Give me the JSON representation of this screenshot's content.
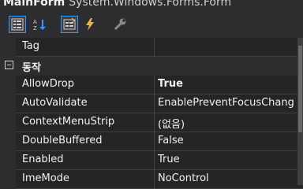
{
  "title": {
    "name": "MainForm",
    "type": "System.Windows.Forms.Form"
  },
  "toolbar": {
    "buttons": [
      {
        "icon": "categorized-icon",
        "active": true
      },
      {
        "icon": "alphabetical-sort-icon",
        "active": false
      },
      {
        "icon": "properties-icon",
        "active": true
      },
      {
        "icon": "events-lightning-icon",
        "active": false
      },
      {
        "icon": "property-pages-wrench-icon",
        "active": false
      }
    ]
  },
  "grid": {
    "tag_row": {
      "name": "Tag",
      "value": ""
    },
    "category": {
      "label": "동작",
      "expanded": true
    },
    "rows": [
      {
        "name": "AllowDrop",
        "value": "True",
        "bold": true
      },
      {
        "name": "AutoValidate",
        "value": "EnablePreventFocusChang",
        "bold": false
      },
      {
        "name": "ContextMenuStrip",
        "value": "(없음)",
        "bold": false
      },
      {
        "name": "DoubleBuffered",
        "value": "False",
        "bold": false
      },
      {
        "name": "Enabled",
        "value": "True",
        "bold": false
      },
      {
        "name": "ImeMode",
        "value": "NoControl",
        "bold": false
      }
    ]
  },
  "colors": {
    "background": "#252526",
    "toolbar": "#2d2d30",
    "active_border": "#3399ff",
    "text": "#f1f1f1"
  }
}
